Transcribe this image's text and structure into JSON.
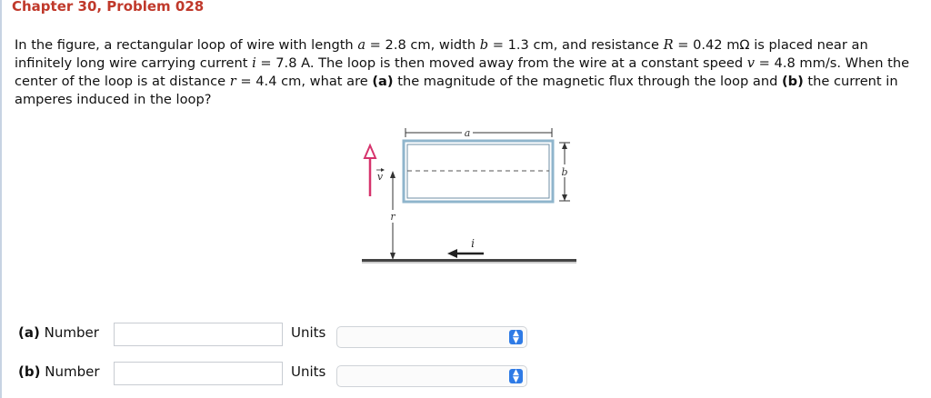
{
  "header": {
    "title": "Chapter 30, Problem 028"
  },
  "problem": {
    "t1": "In the figure, a rectangular loop of wire with length ",
    "v_a": "a",
    "t2": " = 2.8 cm, width ",
    "v_b": "b",
    "t3": " = 1.3 cm, and resistance ",
    "v_R": "R",
    "t4": " = 0.42 mΩ is placed near an infinitely long wire carrying current ",
    "v_i": "i",
    "t5": " = 7.8 A. The loop is then moved away from the wire at a constant speed ",
    "v_v": "v",
    "t6": " = 4.8 mm/s. When the center of the loop is at distance ",
    "v_r": "r",
    "t7": " = 4.4 cm, what are ",
    "part_a": "(a)",
    "t8": " the magnitude of the magnetic flux through the loop and ",
    "part_b": "(b)",
    "t9": " the current in amperes induced in the loop?"
  },
  "figure": {
    "label_a": "a",
    "label_b": "b",
    "label_v": "v",
    "label_r": "r",
    "label_i": "i",
    "colors": {
      "loop": "#8fb5cc",
      "velocity_arrow": "#d6336c"
    }
  },
  "answers": [
    {
      "part": "(a)",
      "label": "Number",
      "value": "",
      "units_label": "Units",
      "units_value": ""
    },
    {
      "part": "(b)",
      "label": "Number",
      "value": "",
      "units_label": "Units",
      "units_value": ""
    }
  ]
}
